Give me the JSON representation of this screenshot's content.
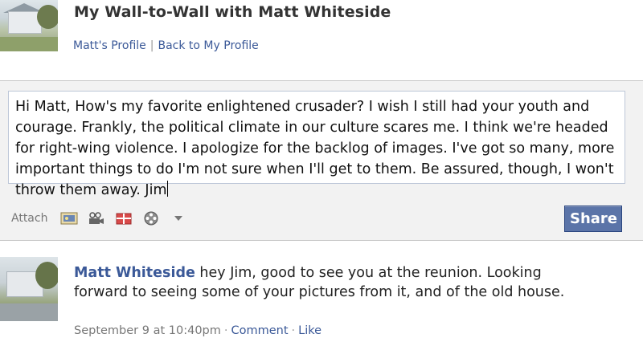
{
  "header": {
    "title": "My Wall-to-Wall with Matt Whiteside",
    "links": {
      "profile": "Matt's Profile",
      "separator": "|",
      "back": "Back to My Profile"
    }
  },
  "composer": {
    "text": "Hi Matt, How's my favorite enlightened crusader? I wish I still had your youth and courage. Frankly, the political climate in our culture scares me. I think we're headed for right-wing violence. I apologize for the backlog of images. I've got so many, more important things to do I'm not sure when I'll get to them. Be assured, though, I won't throw them away. Jim",
    "attach_label": "Attach",
    "attach_icons": [
      "photo-icon",
      "video-icon",
      "gift-icon",
      "film-reel-icon",
      "dropdown-arrow-icon"
    ],
    "share_label": "Share"
  },
  "post": {
    "author": "Matt Whiteside",
    "message": " hey Jim, good to see you at the reunion. Looking forward to seeing some of your pictures from it, and of the old house.",
    "timestamp": "September 9 at 10:40pm",
    "dot": "·",
    "comment": "Comment",
    "like": "Like"
  },
  "colors": {
    "link": "#3b5998",
    "share_button": "#5b74a8",
    "composer_bg": "#f2f2f2"
  }
}
